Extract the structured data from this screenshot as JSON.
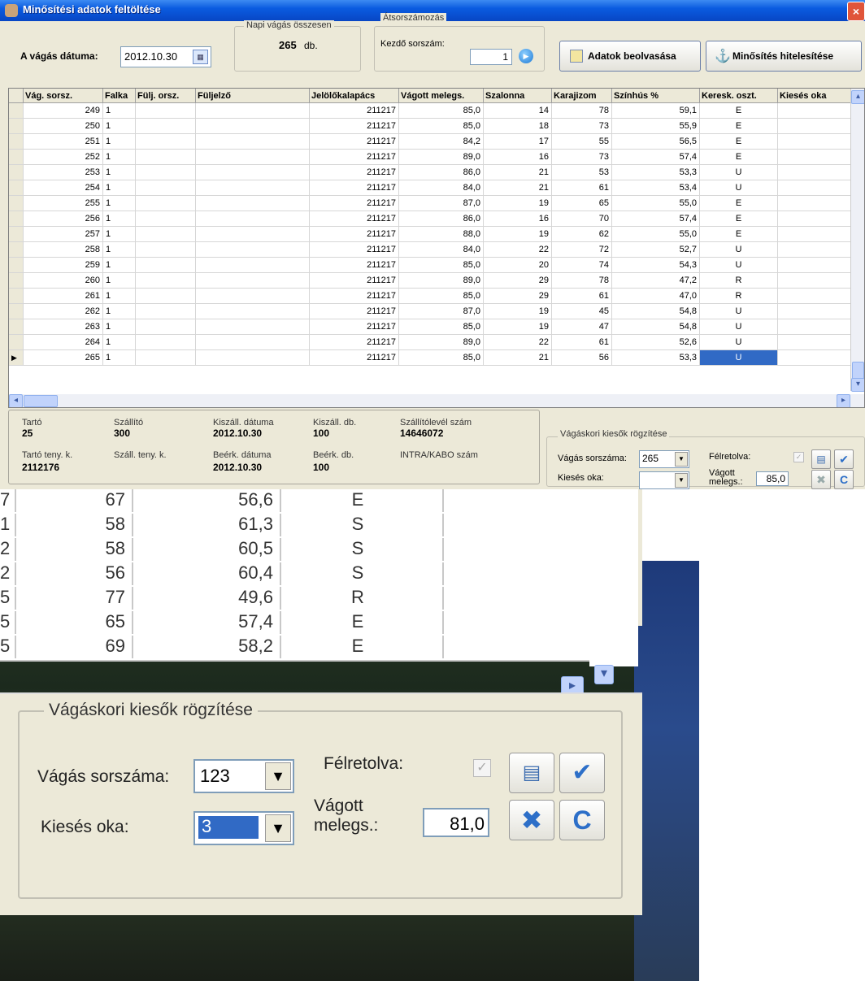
{
  "window": {
    "title": "Minősítési adatok feltöltése",
    "close_symbol": "×"
  },
  "toolbar": {
    "date_label": "A vágás dátuma:",
    "date_value": "2012.10.30",
    "daily_total_title": "Napi vágás összesen",
    "daily_total_value": "265",
    "daily_total_unit": "db.",
    "renumber_title": "Átsorszámozás",
    "start_number_label": "Kezdő sorszám:",
    "start_number_value": "1",
    "read_data_button": "Adatok beolvasása",
    "certify_button": "Minősítés hitelesítése"
  },
  "grid": {
    "columns": [
      "Vág. sorsz.",
      "Falka",
      "Fülj. orsz.",
      "Füljelző",
      "Jelölőkalapács",
      "Vágott melegs.",
      "Szalonna",
      "Karajizom",
      "Színhús %",
      "Keresk. oszt.",
      "Kiesés oka"
    ],
    "rows": [
      [
        "249",
        "1",
        "",
        "",
        "211217",
        "85,0",
        "14",
        "78",
        "59,1",
        "E",
        ""
      ],
      [
        "250",
        "1",
        "",
        "",
        "211217",
        "85,0",
        "18",
        "73",
        "55,9",
        "E",
        ""
      ],
      [
        "251",
        "1",
        "",
        "",
        "211217",
        "84,2",
        "17",
        "55",
        "56,5",
        "E",
        ""
      ],
      [
        "252",
        "1",
        "",
        "",
        "211217",
        "89,0",
        "16",
        "73",
        "57,4",
        "E",
        ""
      ],
      [
        "253",
        "1",
        "",
        "",
        "211217",
        "86,0",
        "21",
        "53",
        "53,3",
        "U",
        ""
      ],
      [
        "254",
        "1",
        "",
        "",
        "211217",
        "84,0",
        "21",
        "61",
        "53,4",
        "U",
        ""
      ],
      [
        "255",
        "1",
        "",
        "",
        "211217",
        "87,0",
        "19",
        "65",
        "55,0",
        "E",
        ""
      ],
      [
        "256",
        "1",
        "",
        "",
        "211217",
        "86,0",
        "16",
        "70",
        "57,4",
        "E",
        ""
      ],
      [
        "257",
        "1",
        "",
        "",
        "211217",
        "88,0",
        "19",
        "62",
        "55,0",
        "E",
        ""
      ],
      [
        "258",
        "1",
        "",
        "",
        "211217",
        "84,0",
        "22",
        "72",
        "52,7",
        "U",
        ""
      ],
      [
        "259",
        "1",
        "",
        "",
        "211217",
        "85,0",
        "20",
        "74",
        "54,3",
        "U",
        ""
      ],
      [
        "260",
        "1",
        "",
        "",
        "211217",
        "89,0",
        "29",
        "78",
        "47,2",
        "R",
        ""
      ],
      [
        "261",
        "1",
        "",
        "",
        "211217",
        "85,0",
        "29",
        "61",
        "47,0",
        "R",
        ""
      ],
      [
        "262",
        "1",
        "",
        "",
        "211217",
        "87,0",
        "19",
        "45",
        "54,8",
        "U",
        ""
      ],
      [
        "263",
        "1",
        "",
        "",
        "211217",
        "85,0",
        "19",
        "47",
        "54,8",
        "U",
        ""
      ],
      [
        "264",
        "1",
        "",
        "",
        "211217",
        "89,0",
        "22",
        "61",
        "52,6",
        "U",
        ""
      ],
      [
        "265",
        "1",
        "",
        "",
        "211217",
        "85,0",
        "21",
        "56",
        "53,3",
        "U",
        ""
      ]
    ],
    "current_row_marker": "▶"
  },
  "info": {
    "holder_label": "Tartó",
    "holder_value": "25",
    "supplier_label": "Szállító",
    "supplier_value": "300",
    "delivery_date_label": "Kiszáll. dátuma",
    "delivery_date_value": "2012.10.30",
    "delivery_count_label": "Kiszáll. db.",
    "delivery_count_value": "100",
    "waybill_label": "Szállítólevél szám",
    "waybill_value": "14646072",
    "holder_farm_label": "Tartó teny. k.",
    "holder_farm_value": "2112176",
    "supplier_farm_label": "Száll. teny. k.",
    "arrival_date_label": "Beérk. dátuma",
    "arrival_date_value": "2012.10.30",
    "arrival_count_label": "Beérk. db.",
    "arrival_count_value": "100",
    "intra_label": "INTRA/KABO szám"
  },
  "losses": {
    "title": "Vágáskori kiesők rögzítése",
    "serial_label": "Vágás sorszáma:",
    "serial_value": "265",
    "reason_label": "Kiesés oka:",
    "reason_value": "",
    "set_aside_label": "Félretolva:",
    "weight_label_1": "Vágott",
    "weight_label_2": "melegs.:",
    "weight_value": "85,0"
  },
  "zoom": {
    "rows": [
      [
        "7",
        "67",
        "56,6",
        "E"
      ],
      [
        "1",
        "58",
        "61,3",
        "S"
      ],
      [
        "2",
        "58",
        "60,5",
        "S"
      ],
      [
        "2",
        "56",
        "60,4",
        "S"
      ],
      [
        "5",
        "77",
        "49,6",
        "R"
      ],
      [
        "5",
        "65",
        "57,4",
        "E"
      ],
      [
        "5",
        "69",
        "58,2",
        "E"
      ]
    ],
    "losses_title": "Vágáskori kiesők rögzítése",
    "serial_label": "Vágás sorszáma:",
    "serial_value": "123",
    "reason_label": "Kiesés oka:",
    "reason_value": "3",
    "set_aside_label": "Félretolva:",
    "weight_label_1": "Vágott",
    "weight_label_2": "melegs.:",
    "weight_value": "81,0"
  },
  "colors": {
    "selection": "#316ac5",
    "titlebar": "#0a5be0"
  }
}
